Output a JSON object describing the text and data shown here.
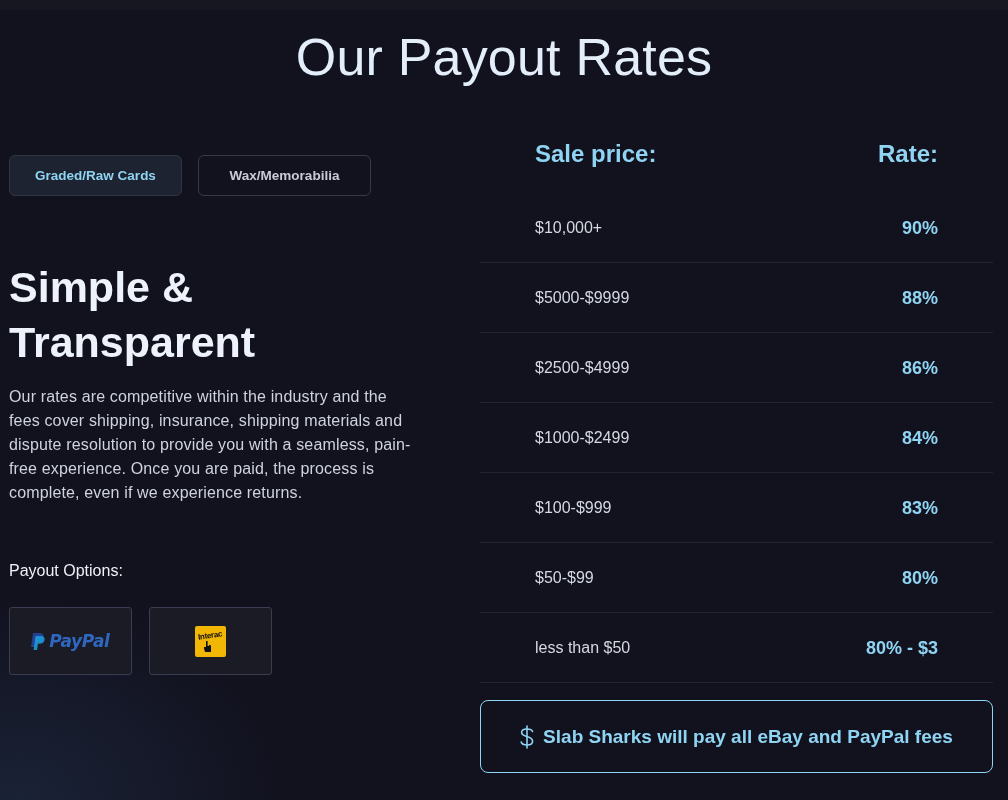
{
  "title": "Our Payout Rates",
  "tabs": [
    {
      "label": "Graded/Raw Cards",
      "selected": true
    },
    {
      "label": "Wax/Memorabilia",
      "selected": false
    }
  ],
  "intro": {
    "heading": "Simple & Transparent",
    "body": "Our rates are competitive within the industry and the fees cover shipping, insurance, shipping materials and dispute resolution to provide you with a seamless, pain-free experience. Once you are paid, the process is complete, even if we experience returns."
  },
  "payout_options": {
    "label": "Payout Options:",
    "items": [
      {
        "kind": "paypal",
        "label": "PayPal"
      },
      {
        "kind": "interac",
        "label": "Interac"
      }
    ]
  },
  "rates_table": {
    "columns": [
      "Sale price:",
      "Rate:"
    ],
    "rows": [
      {
        "price": "$10,000+",
        "rate": "90%"
      },
      {
        "price": "$5000-$9999",
        "rate": "88%"
      },
      {
        "price": "$2500-$4999",
        "rate": "86%"
      },
      {
        "price": "$1000-$2499",
        "rate": "84%"
      },
      {
        "price": "$100-$999",
        "rate": "83%"
      },
      {
        "price": "$50-$99",
        "rate": "80%"
      },
      {
        "price": "less than $50",
        "rate": "80% - $3"
      }
    ]
  },
  "note": {
    "text": "Slab Sharks will pay all eBay and PayPal fees"
  }
}
